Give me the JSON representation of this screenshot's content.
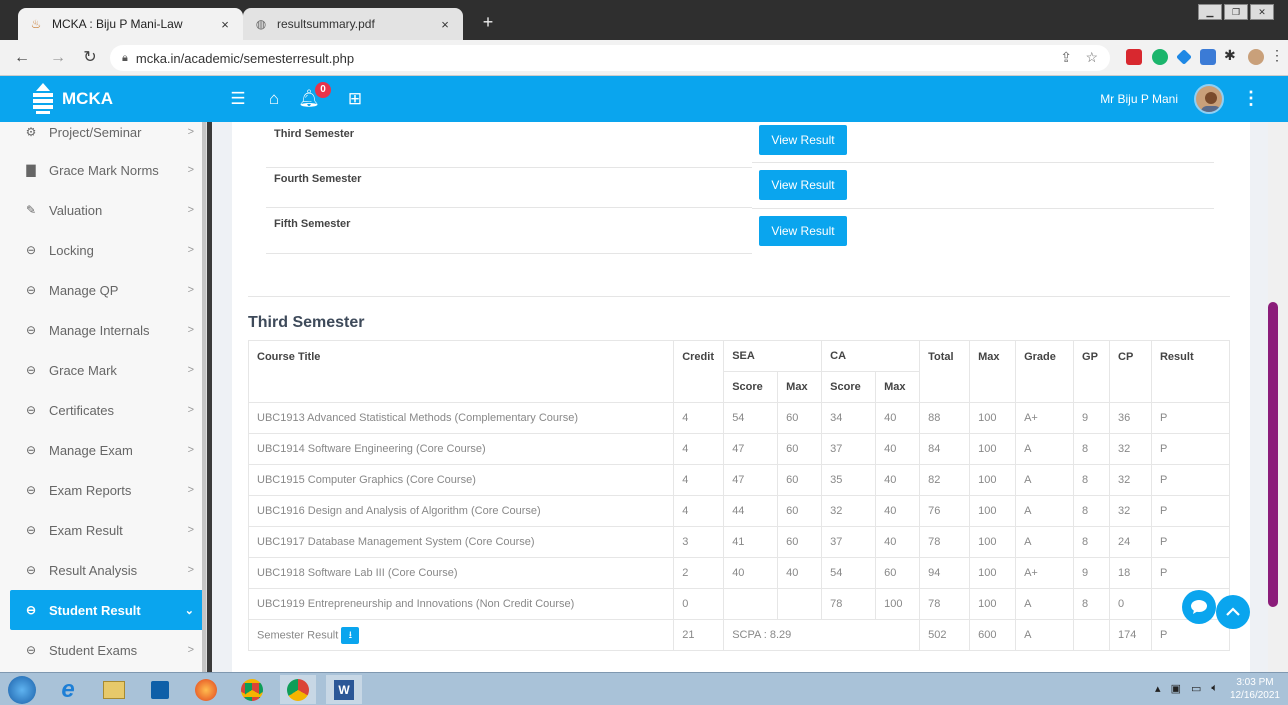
{
  "browser": {
    "tabs": [
      {
        "title": "MCKA : Biju P Mani-Law",
        "close": "×"
      },
      {
        "title": "resultsummary.pdf",
        "close": "×"
      }
    ],
    "new_tab": "+",
    "url": "mcka.in/academic/semesterresult.php"
  },
  "app": {
    "brand": "MCKA",
    "notification_count": "0",
    "user_name": "Mr Biju P Mani"
  },
  "sidebar": {
    "items": [
      {
        "label": "Project/Seminar",
        "icon": "gears-icon"
      },
      {
        "label": "Grace Mark Norms",
        "icon": "book-icon"
      },
      {
        "label": "Valuation",
        "icon": "pencil-icon"
      },
      {
        "label": "Locking",
        "icon": "circle-icon"
      },
      {
        "label": "Manage QP",
        "icon": "circle-icon"
      },
      {
        "label": "Manage Internals",
        "icon": "circle-icon"
      },
      {
        "label": "Grace Mark",
        "icon": "circle-icon"
      },
      {
        "label": "Certificates",
        "icon": "circle-icon"
      },
      {
        "label": "Manage Exam",
        "icon": "circle-icon"
      },
      {
        "label": "Exam Reports",
        "icon": "circle-icon"
      },
      {
        "label": "Exam Result",
        "icon": "circle-icon"
      },
      {
        "label": "Result Analysis",
        "icon": "circle-icon"
      },
      {
        "label": "Student Result",
        "icon": "circle-icon",
        "active": true
      },
      {
        "label": "Student Exams",
        "icon": "circle-icon"
      }
    ]
  },
  "semesters": [
    {
      "label": "Third Semester",
      "button": "View Result"
    },
    {
      "label": "Fourth Semester",
      "button": "View Result"
    },
    {
      "label": "Fifth Semester",
      "button": "View Result"
    }
  ],
  "result": {
    "title": "Third Semester",
    "headers": {
      "course": "Course Title",
      "credit": "Credit",
      "sea": "SEA",
      "ca": "CA",
      "total": "Total",
      "max": "Max",
      "grade": "Grade",
      "gp": "GP",
      "cp": "CP",
      "result": "Result",
      "score": "Score",
      "sub_max": "Max"
    },
    "rows": [
      [
        "UBC1913 Advanced Statistical Methods (Complementary Course)",
        "4",
        "54",
        "60",
        "34",
        "40",
        "88",
        "100",
        "A+",
        "9",
        "36",
        "P"
      ],
      [
        "UBC1914 Software Engineering (Core Course)",
        "4",
        "47",
        "60",
        "37",
        "40",
        "84",
        "100",
        "A",
        "8",
        "32",
        "P"
      ],
      [
        "UBC1915 Computer Graphics (Core Course)",
        "4",
        "47",
        "60",
        "35",
        "40",
        "82",
        "100",
        "A",
        "8",
        "32",
        "P"
      ],
      [
        "UBC1916 Design and Analysis of Algorithm (Core Course)",
        "4",
        "44",
        "60",
        "32",
        "40",
        "76",
        "100",
        "A",
        "8",
        "32",
        "P"
      ],
      [
        "UBC1917 Database Management System (Core Course)",
        "3",
        "41",
        "60",
        "37",
        "40",
        "78",
        "100",
        "A",
        "8",
        "24",
        "P"
      ],
      [
        "UBC1918 Software Lab III (Core Course)",
        "2",
        "40",
        "40",
        "54",
        "60",
        "94",
        "100",
        "A+",
        "9",
        "18",
        "P"
      ],
      [
        "UBC1919 Entrepreneurship and Innovations (Non Credit Course)",
        "0",
        "",
        "",
        "78",
        "100",
        "78",
        "100",
        "A",
        "8",
        "0",
        ""
      ]
    ],
    "summary": {
      "label": "Semester Result",
      "credit": "21",
      "scpa": "SCPA : 8.29",
      "total": "502",
      "max": "600",
      "grade": "A",
      "gp": "",
      "cp": "174",
      "result": "P"
    }
  },
  "taskbar": {
    "time": "3:03 PM",
    "date": "12/16/2021"
  }
}
